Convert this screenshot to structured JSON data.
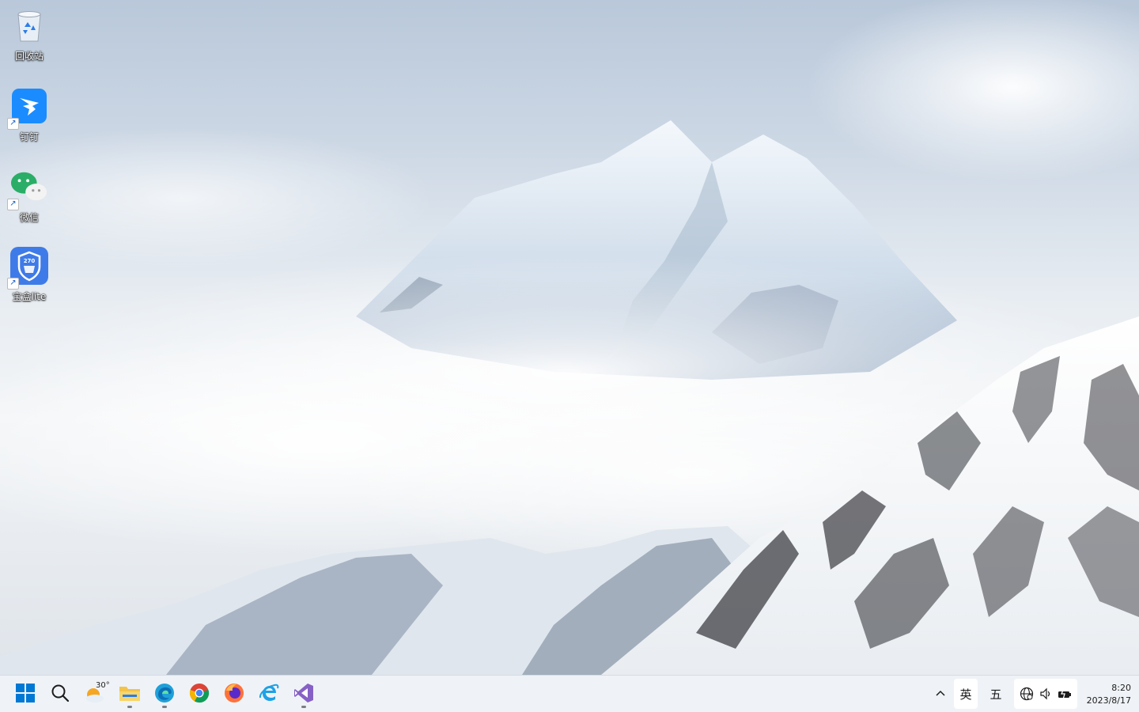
{
  "desktop": {
    "icons": [
      {
        "label": "回收站",
        "icon": "recycle-bin-icon"
      },
      {
        "label": "钉钉",
        "icon": "dingtalk-icon"
      },
      {
        "label": "微信",
        "icon": "wechat-icon"
      },
      {
        "label": "宝盒lite",
        "icon": "baohe-lite-icon"
      }
    ],
    "baohe_badge": "270",
    "shortcut_glyph": "↗"
  },
  "taskbar": {
    "apps": [
      {
        "name": "start",
        "icon": "windows-start-icon"
      },
      {
        "name": "search",
        "icon": "search-icon"
      },
      {
        "name": "weather",
        "icon": "weather-icon",
        "temperature": "30°"
      },
      {
        "name": "file-explorer",
        "icon": "folder-icon"
      },
      {
        "name": "edge",
        "icon": "edge-icon"
      },
      {
        "name": "chrome",
        "icon": "chrome-icon"
      },
      {
        "name": "firefox",
        "icon": "firefox-icon"
      },
      {
        "name": "ie",
        "icon": "ie-icon"
      },
      {
        "name": "visual-studio",
        "icon": "visual-studio-icon"
      }
    ],
    "tray": {
      "chevron": "^",
      "ime_language": "英",
      "ime_mode": "五",
      "time": "8:20",
      "date": "2023/8/17"
    }
  },
  "colors": {
    "taskbar_bg": "#eef2f7",
    "accent": "#0078d4",
    "dingtalk": "#1a8cff",
    "wechat": "#2aae67"
  }
}
